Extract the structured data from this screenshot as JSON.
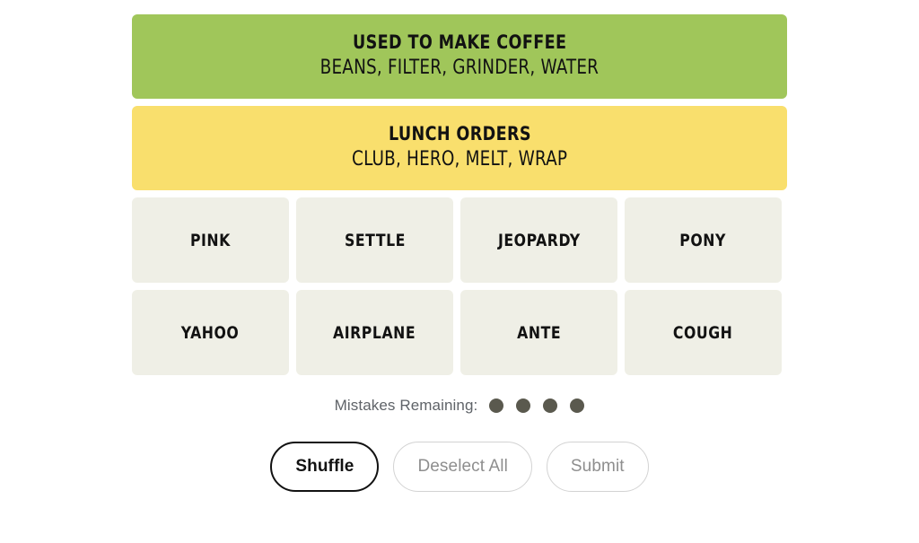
{
  "solved_groups": [
    {
      "title": "USED TO MAKE COFFEE",
      "members": "BEANS, FILTER, GRINDER, WATER",
      "color": "#a0c65a"
    },
    {
      "title": "LUNCH ORDERS",
      "members": "CLUB, HERO, MELT, WRAP",
      "color": "#f9df6d"
    }
  ],
  "tile_rows": [
    [
      {
        "label": "PINK"
      },
      {
        "label": "SETTLE"
      },
      {
        "label": "JEOPARDY"
      },
      {
        "label": "PONY"
      }
    ],
    [
      {
        "label": "YAHOO"
      },
      {
        "label": "AIRPLANE"
      },
      {
        "label": "ANTE"
      },
      {
        "label": "COUGH"
      }
    ]
  ],
  "tile_color": "#efefe6",
  "mistakes": {
    "label": "Mistakes Remaining:",
    "remaining": 4,
    "dot_color": "#5a594e"
  },
  "controls": [
    {
      "label": "Shuffle",
      "state": "active"
    },
    {
      "label": "Deselect All",
      "state": "disabled"
    },
    {
      "label": "Submit",
      "state": "disabled"
    }
  ]
}
